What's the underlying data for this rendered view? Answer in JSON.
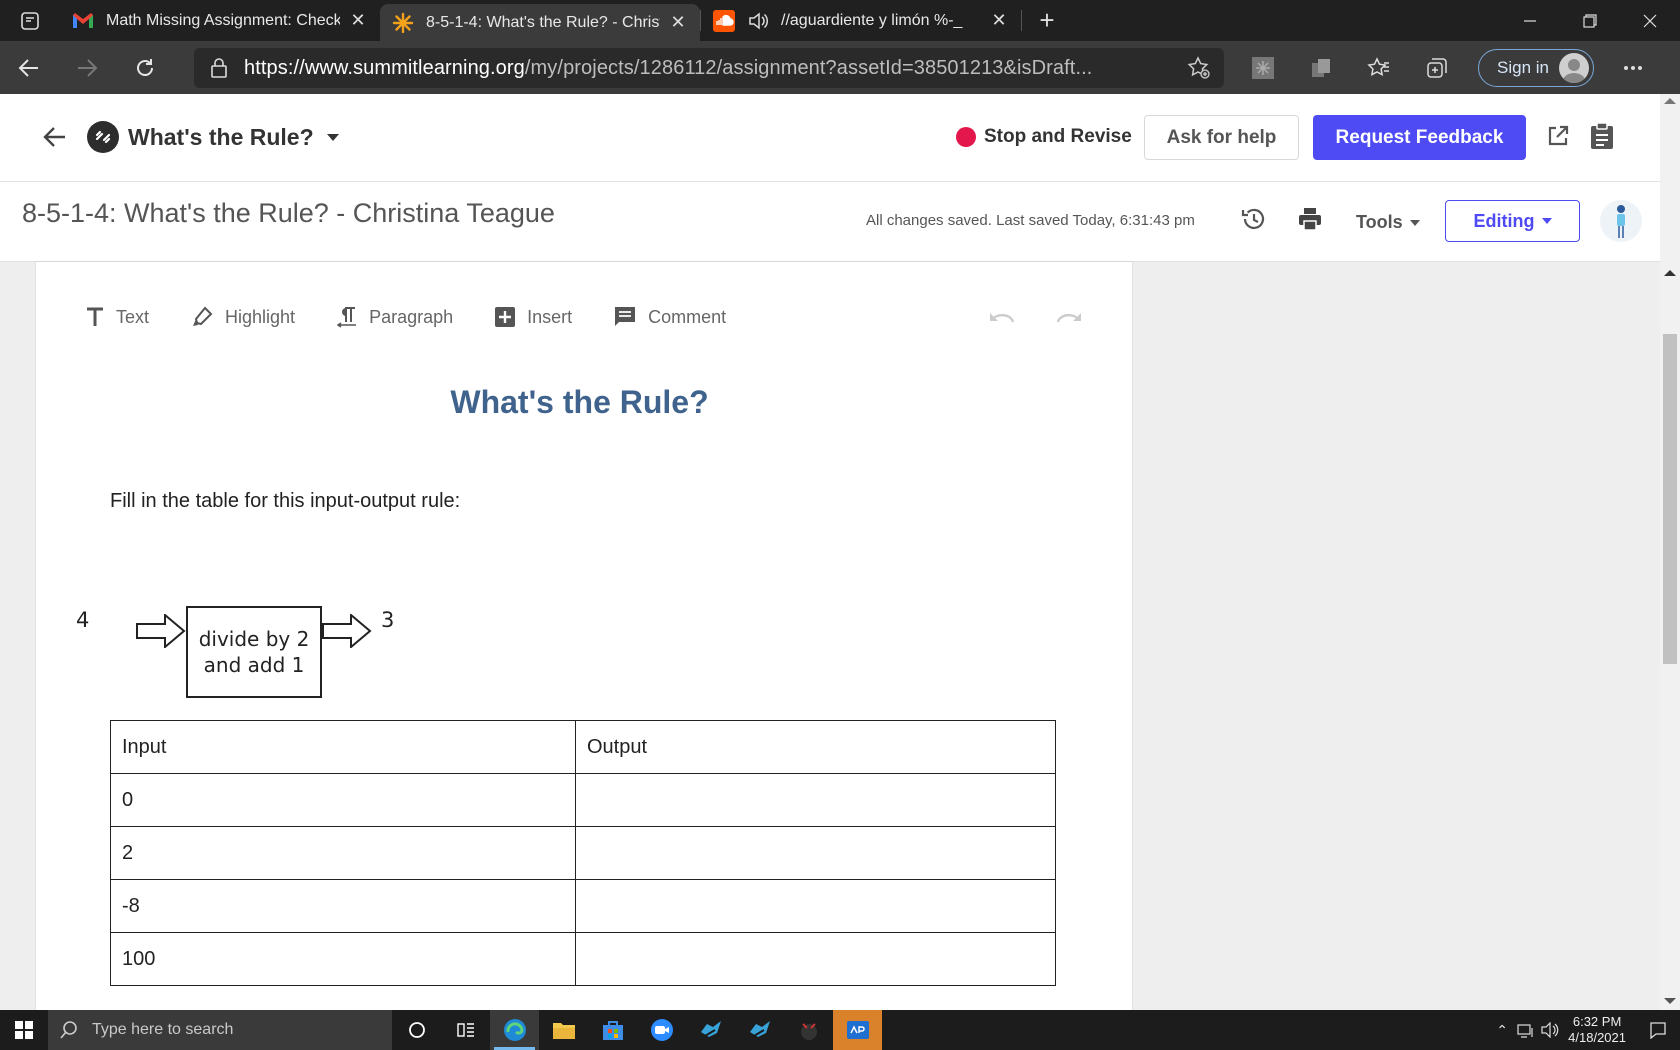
{
  "browser": {
    "tabs": [
      {
        "title": "Math Missing Assignment: Check",
        "icon": "gmail-icon",
        "active": false
      },
      {
        "title": "8-5-1-4: What's the Rule? - Christ",
        "icon": "summit-icon",
        "active": true
      },
      {
        "title": "//aguardiente y limón %-_",
        "icon": "soundcloud-icon",
        "active": false
      }
    ],
    "url_domain": "https://www.summitlearning.org",
    "url_path": "/my/projects/1286112/assignment?assetId=38501213&isDraft...",
    "sign_in_label": "Sign in"
  },
  "app_header": {
    "project_title": "What's the Rule?",
    "stop_revise_label": "Stop and Revise",
    "ask_help_label": "Ask for help",
    "request_feedback_label": "Request Feedback",
    "accent_color": "#4e4bf5",
    "stop_color": "#e3174b"
  },
  "doc_header": {
    "title": "8-5-1-4: What's the Rule?  - Christina Teague",
    "saved_status": "All changes saved. Last saved Today, 6:31:43 pm",
    "tools_label": "Tools",
    "editing_label": "Editing"
  },
  "editor_toolbar": {
    "text_label": "Text",
    "highlight_label": "Highlight",
    "paragraph_label": "Paragraph",
    "insert_label": "Insert",
    "comment_label": "Comment"
  },
  "document": {
    "heading": "What's the Rule?",
    "instructions": "Fill in the table for this input-output rule:",
    "diagram": {
      "input": "4",
      "rule_line1": "divide by 2",
      "rule_line2": "and add 1",
      "output": "3"
    },
    "table": {
      "headers": [
        "Input",
        "Output"
      ],
      "rows": [
        [
          "0",
          ""
        ],
        [
          "2",
          ""
        ],
        [
          "-8",
          ""
        ],
        [
          "100",
          ""
        ]
      ]
    }
  },
  "taskbar": {
    "search_placeholder": "Type here to search",
    "time": "6:32 PM",
    "date": "4/18/2021"
  }
}
